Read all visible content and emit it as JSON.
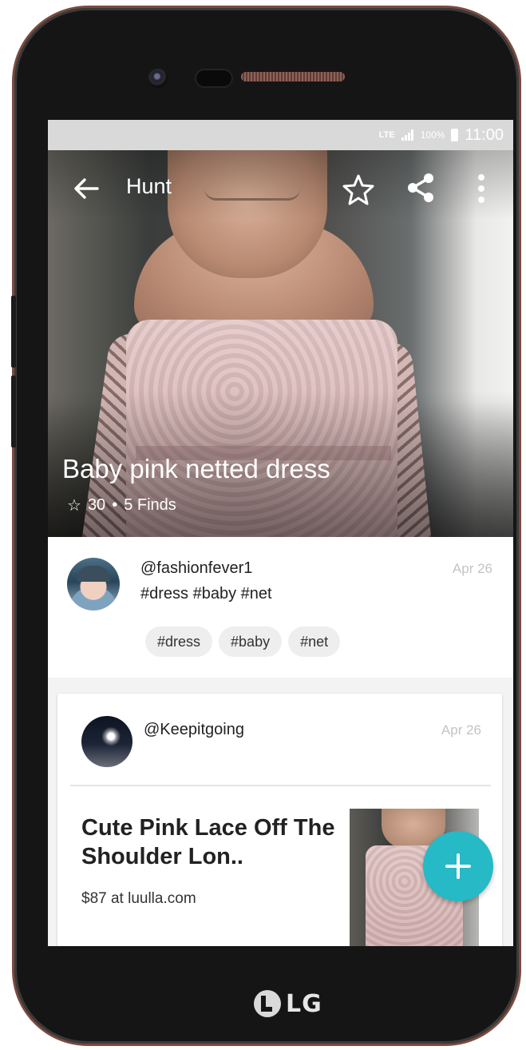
{
  "device": {
    "brand_logo": "LG"
  },
  "status_bar": {
    "network": "LTE",
    "battery": "100%",
    "time": "11:00"
  },
  "toolbar": {
    "title": "Hunt"
  },
  "hero": {
    "title": "Baby pink netted dress",
    "star_count": "30",
    "separator": "•",
    "finds": "5 Finds"
  },
  "post": {
    "handle": "@fashionfever1",
    "date": "Apr 26",
    "tags_text": "#dress #baby #net",
    "chips": [
      "#dress",
      "#baby",
      "#net"
    ]
  },
  "find_card": {
    "handle": "@Keepitgoing",
    "date": "Apr 26",
    "title": "Cute Pink Lace Off The Shoulder Lon..",
    "price": "$87 at luulla.com"
  },
  "colors": {
    "accent": "#26b9c6",
    "status_bar": "#d9d9d9"
  },
  "icons": {
    "back": "arrow-left-icon",
    "favorite": "star-outline-icon",
    "share": "share-icon",
    "more": "more-vert-icon",
    "fab": "plus-icon"
  }
}
